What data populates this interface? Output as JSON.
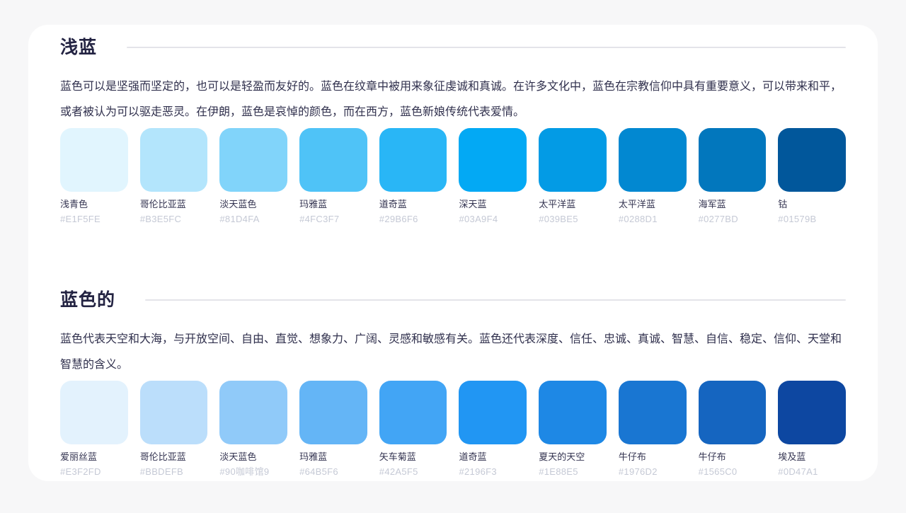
{
  "page": {
    "background_color": "#f7f7f8",
    "card_background_color": "#ffffff"
  },
  "sections": [
    {
      "title": "浅蓝",
      "description": "蓝色可以是坚强而坚定的，也可以是轻盈而友好的。蓝色在纹章中被用来象征虔诚和真诚。在许多文化中，蓝色在宗教信仰中具有重要意义，可以带来和平，或者被认为可以驱走恶灵。在伊朗，蓝色是哀悼的颜色，而在西方，蓝色新娘传统代表爱情。",
      "swatches": [
        {
          "name": "浅青色",
          "hex": "#E1F5FE",
          "color": "#E1F5FE"
        },
        {
          "name": "哥伦比亚蓝",
          "hex": "#B3E5FC",
          "color": "#B3E5FC"
        },
        {
          "name": "淡天蓝色",
          "hex": "#81D4FA",
          "color": "#81D4FA"
        },
        {
          "name": "玛雅蓝",
          "hex": "#4FC3F7",
          "color": "#4FC3F7"
        },
        {
          "name": "道奇蓝",
          "hex": "#29B6F6",
          "color": "#29B6F6"
        },
        {
          "name": "深天蓝",
          "hex": "#03A9F4",
          "color": "#03A9F4"
        },
        {
          "name": "太平洋蓝",
          "hex": "#039BE5",
          "color": "#039BE5"
        },
        {
          "name": "太平洋蓝",
          "hex": "#0288D1",
          "color": "#0288D1"
        },
        {
          "name": "海军蓝",
          "hex": "#0277BD",
          "color": "#0277BD"
        },
        {
          "name": "钴",
          "hex": "#01579B",
          "color": "#01579B"
        }
      ]
    },
    {
      "title": "蓝色的",
      "description": "蓝色代表天空和大海，与开放空间、自由、直觉、想象力、广阔、灵感和敏感有关。蓝色还代表深度、信任、忠诚、真诚、智慧、自信、稳定、信仰、天堂和智慧的含义。",
      "swatches": [
        {
          "name": "爱丽丝蓝",
          "hex": "#E3F2FD",
          "color": "#E3F2FD"
        },
        {
          "name": "哥伦比亚蓝",
          "hex": "#BBDEFB",
          "color": "#BBDEFB"
        },
        {
          "name": "淡天蓝色",
          "hex": "#90咖啡馆9",
          "color": "#90CAF9"
        },
        {
          "name": "玛雅蓝",
          "hex": "#64B5F6",
          "color": "#64B5F6"
        },
        {
          "name": "矢车菊蓝",
          "hex": "#42A5F5",
          "color": "#42A5F5"
        },
        {
          "name": "道奇蓝",
          "hex": "#2196F3",
          "color": "#2196F3"
        },
        {
          "name": "夏天的天空",
          "hex": "#1E88E5",
          "color": "#1E88E5"
        },
        {
          "name": "牛仔布",
          "hex": "#1976D2",
          "color": "#1976D2"
        },
        {
          "name": "牛仔布",
          "hex": "#1565C0",
          "color": "#1565C0"
        },
        {
          "name": "埃及蓝",
          "hex": "#0D47A1",
          "color": "#0D47A1"
        }
      ]
    }
  ]
}
